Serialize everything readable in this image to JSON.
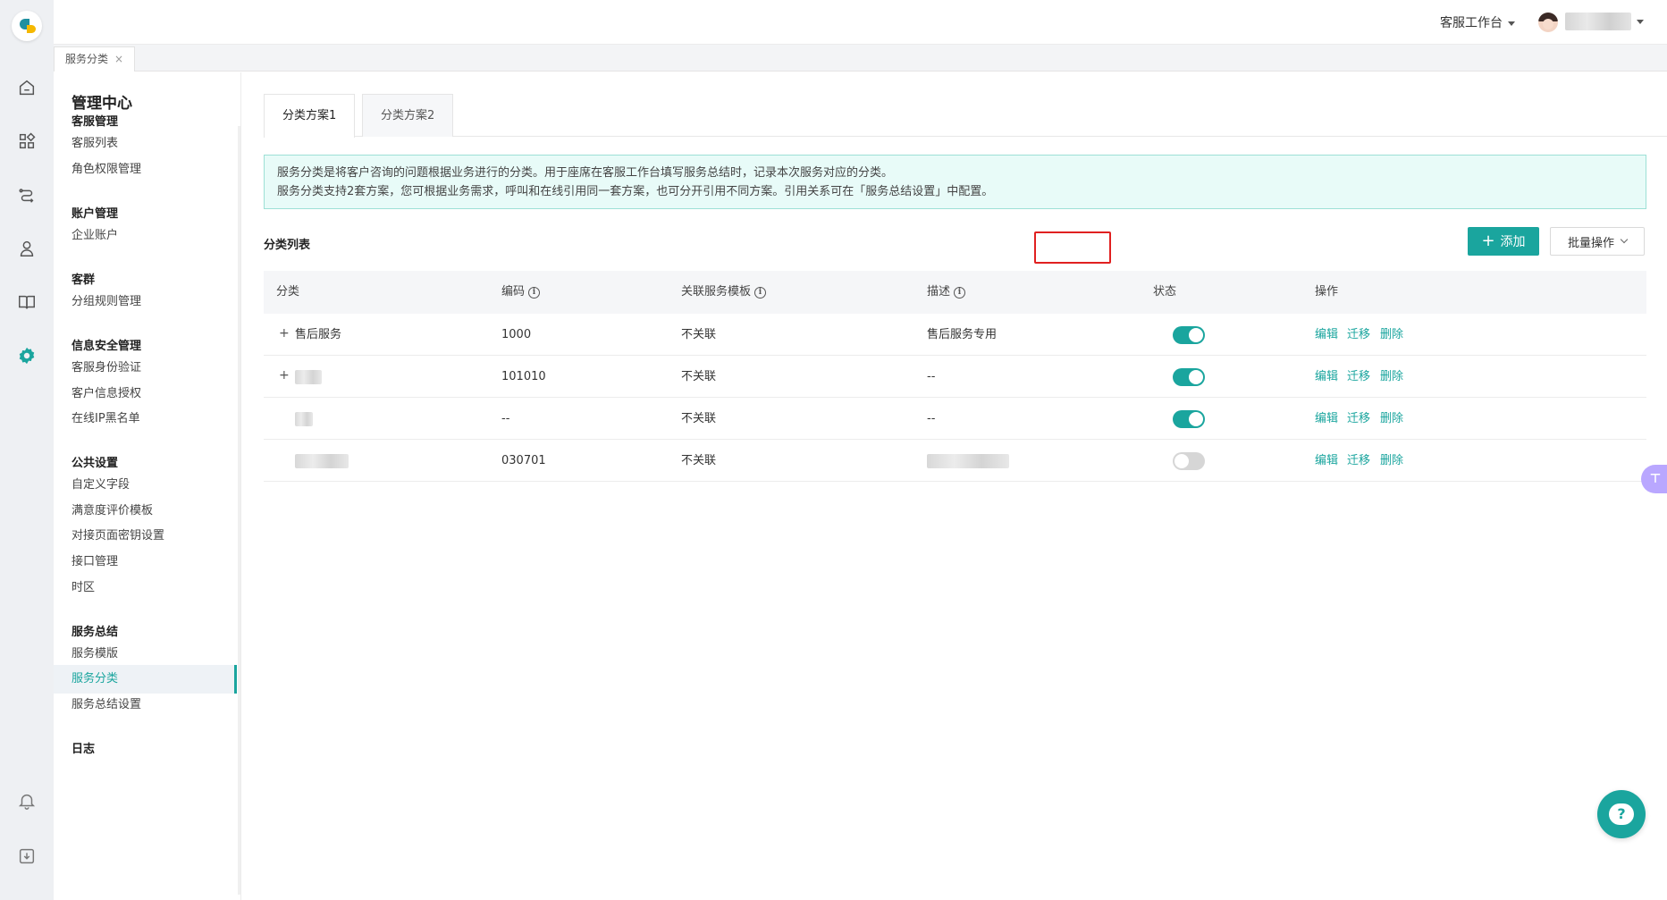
{
  "topbar": {
    "workspace_label": "客服工作台"
  },
  "tab_strip": {
    "tab_label": "服务分类",
    "close_glyph": "×"
  },
  "subnav": {
    "title": "管理中心",
    "groups": [
      {
        "label": "客服管理",
        "items": [
          "客服列表",
          "角色权限管理"
        ]
      },
      {
        "label": "账户管理",
        "items": [
          "企业账户"
        ]
      },
      {
        "label": "客群",
        "items": [
          "分组规则管理"
        ]
      },
      {
        "label": "信息安全管理",
        "items": [
          "客服身份验证",
          "客户信息授权",
          "在线IP黑名单"
        ]
      },
      {
        "label": "公共设置",
        "items": [
          "自定义字段",
          "满意度评价模板",
          "对接页面密钥设置",
          "接口管理",
          "时区"
        ]
      },
      {
        "label": "服务总结",
        "items": [
          "服务模版",
          "服务分类",
          "服务总结设置"
        ]
      },
      {
        "label": "日志",
        "items": []
      }
    ],
    "active_item": "服务分类"
  },
  "page_tabs": [
    "分类方案1",
    "分类方案2"
  ],
  "notice": {
    "line1": "服务分类是将客户咨询的问题根据业务进行的分类。用于座席在客服工作台填写服务总结时，记录本次服务对应的分类。",
    "line2": "服务分类支持2套方案，您可根据业务需求，呼叫和在线引用同一套方案，也可分开引用不同方案。引用关系可在「服务总结设置」中配置。"
  },
  "list": {
    "title": "分类列表",
    "add_label": "添加",
    "batch_label": "批量操作",
    "columns": [
      "分类",
      "编码",
      "关联服务模板",
      "描述",
      "状态",
      "操作"
    ],
    "rows": [
      {
        "category": "售后服务",
        "code": "1000",
        "template": "不关联",
        "desc": "售后服务专用",
        "enabled": true
      },
      {
        "category": "",
        "code": "101010",
        "template": "不关联",
        "desc": "--",
        "enabled": true
      },
      {
        "category": "",
        "code": "--",
        "template": "不关联",
        "desc": "--",
        "enabled": true
      },
      {
        "category": "",
        "code": "030701",
        "template": "不关联",
        "desc": "",
        "enabled": false
      }
    ],
    "actions": {
      "edit": "编辑",
      "move": "迁移",
      "delete": "删除"
    }
  },
  "colors": {
    "accent": "#1aa59e",
    "highlight": "#e02020"
  },
  "icons": [
    "home-icon",
    "apps-icon",
    "route-icon",
    "users-icon",
    "book-icon",
    "settings-icon",
    "bell-icon",
    "download-icon",
    "help-chat-icon"
  ]
}
